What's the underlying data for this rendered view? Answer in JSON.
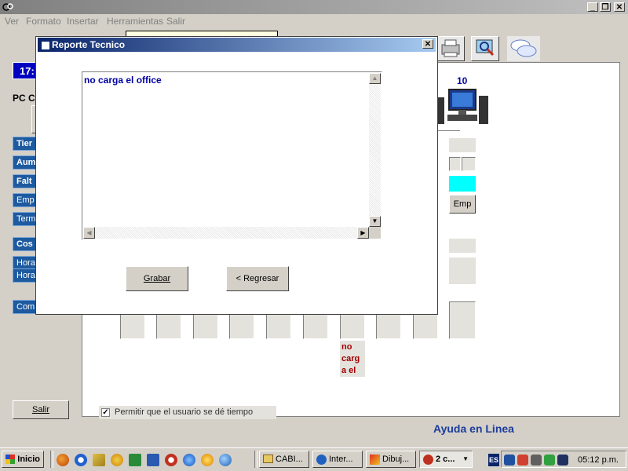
{
  "app": {
    "menu": [
      "Ver",
      "Formato",
      "Insertar",
      "Herramientas",
      "Salir"
    ],
    "counter": "17:",
    "pc_label": "PC  C",
    "pc_number": "10",
    "help_link": "Ayuda en Linea",
    "exit_button": "Salir",
    "emp_button": "Emp",
    "note_text": "no carg a el",
    "checkbox_label": "Permitir que el usuario se dé tiempo",
    "checkbox_checked": true,
    "side_labels": [
      "Tier",
      "Aum",
      "Falt",
      "Emp",
      "Term",
      "Cos",
      "Hora",
      "Hora",
      "Com"
    ]
  },
  "dialog": {
    "title": "Reporte Tecnico",
    "text_value": "no carga el office",
    "save_button": "Grabar",
    "back_button": "< Regresar"
  },
  "taskbar": {
    "start": "Inicio",
    "tasks": [
      "CABI...",
      "Inter...",
      "Dibuj...",
      "2 c..."
    ],
    "lang": "ES",
    "clock": "05:12 p.m."
  },
  "colors": {
    "title_active": "#0a246a",
    "title_gradient_end": "#a6caf0",
    "label_blue": "#1d5aa0",
    "help_link": "#1c3c9c",
    "note_red": "#a00000",
    "cyan_box": "#00ffff"
  }
}
